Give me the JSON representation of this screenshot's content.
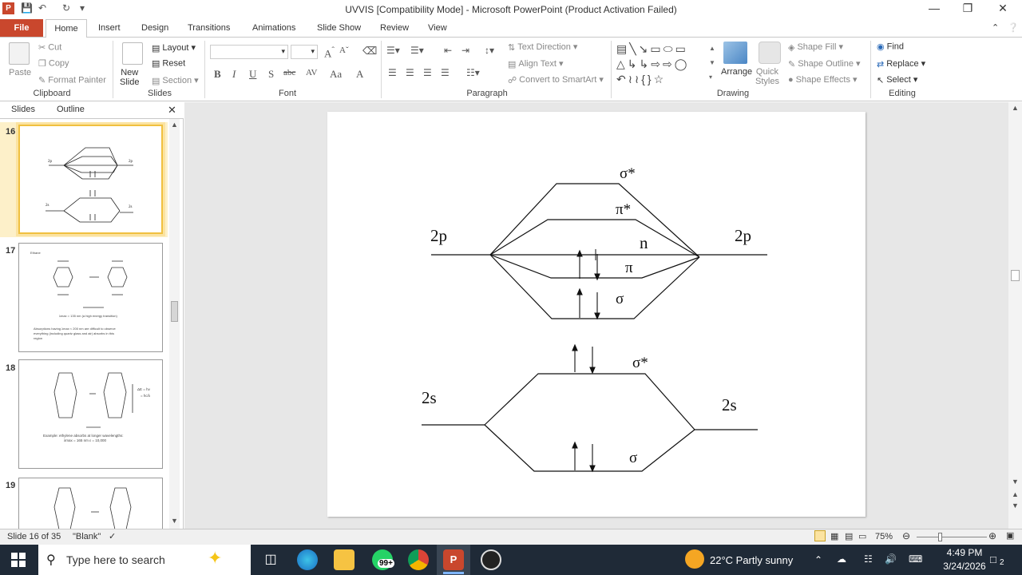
{
  "window": {
    "title": "UVVIS [Compatibility Mode]  -  Microsoft PowerPoint (Product Activation Failed)",
    "app_icon": "powerpoint-icon",
    "controls": [
      "minimize",
      "restore",
      "close"
    ]
  },
  "menu": {
    "file": "File",
    "tabs": [
      "Home",
      "Insert",
      "Design",
      "Transitions",
      "Animations",
      "Slide Show",
      "Review",
      "View"
    ]
  },
  "ribbon": {
    "clipboard": {
      "label": "Clipboard",
      "paste": "Paste",
      "cut": "Cut",
      "copy": "Copy",
      "format_painter": "Format Painter"
    },
    "slides": {
      "label": "Slides",
      "new_slide_1": "New",
      "new_slide_2": "Slide",
      "layout": "Layout",
      "reset": "Reset",
      "section": "Section"
    },
    "font": {
      "label": "Font",
      "bold": "B",
      "italic": "I",
      "underline": "U",
      "strike": "abc",
      "shadow": "S",
      "spacing": "AV",
      "case": "Aa",
      "color": "A"
    },
    "paragraph": {
      "label": "Paragraph",
      "text_direction": "Text Direction",
      "align_text": "Align Text",
      "convert_smartart": "Convert to SmartArt"
    },
    "drawing": {
      "label": "Drawing",
      "arrange": "Arrange",
      "quick_styles_1": "Quick",
      "quick_styles_2": "Styles",
      "shape_fill": "Shape Fill",
      "shape_outline": "Shape Outline",
      "shape_effects": "Shape Effects"
    },
    "editing": {
      "label": "Editing",
      "find": "Find",
      "replace": "Replace",
      "select": "Select"
    }
  },
  "pane": {
    "tab_slides": "Slides",
    "tab_outline": "Outline",
    "thumbnails": [
      {
        "number": "16",
        "selected": true
      },
      {
        "number": "17",
        "selected": false
      },
      {
        "number": "18",
        "selected": false
      },
      {
        "number": "19",
        "selected": false
      }
    ]
  },
  "slide": {
    "labels": {
      "left_2p": "2p",
      "right_2p": "2p",
      "sigma_star_top": "σ*",
      "pi_star": "π*",
      "n": "n",
      "pi": "π",
      "sigma_mid": "σ",
      "left_2s": "2s",
      "right_2s": "2s",
      "sigma_star_low": "σ*",
      "sigma_low": "σ"
    }
  },
  "status": {
    "slide_info": "Slide 16 of 35",
    "theme": "\"Blank\"",
    "zoom": "75%"
  },
  "taskbar": {
    "search_placeholder": "Type here to search",
    "whatsapp_badge": "99+",
    "weather": "22°C  Partly sunny",
    "time": "4:49 PM",
    "date": "3/24/2026",
    "notifications": "2"
  }
}
